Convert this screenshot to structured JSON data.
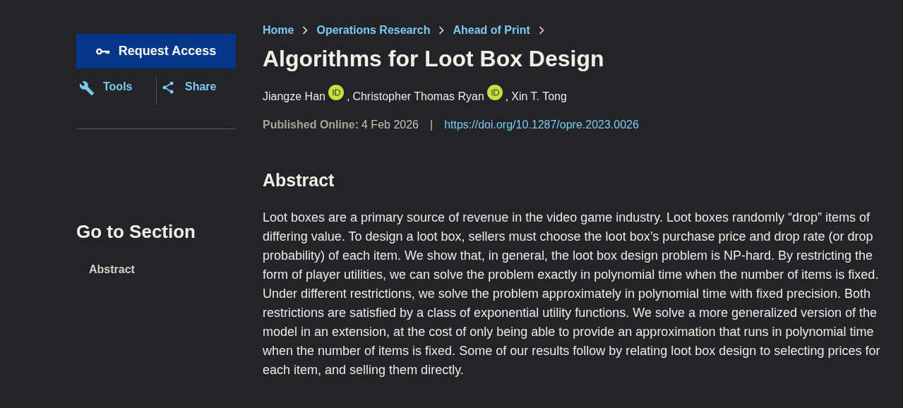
{
  "sidebar": {
    "request_access": "Request Access",
    "tools": "Tools",
    "share": "Share",
    "section_heading": "Go to Section",
    "sections": [
      {
        "label": "Abstract"
      }
    ]
  },
  "breadcrumbs": [
    "Home",
    "Operations Research",
    "Ahead of Print"
  ],
  "title": "Algorithms for Loot Box Design",
  "authors": [
    {
      "name": "Jiangze Han",
      "orcid": true,
      "separator": ","
    },
    {
      "name": "Christopher Thomas Ryan",
      "orcid": true,
      "separator": ","
    },
    {
      "name": "Xin T. Tong",
      "orcid": false
    }
  ],
  "published": {
    "label": "Published Online:",
    "date": "4 Feb 2026",
    "separator": "|",
    "doi": "https://doi.org/10.1287/opre.2023.0026"
  },
  "abstract": {
    "heading": "Abstract",
    "text": "Loot boxes are a primary source of revenue in the video game industry. Loot boxes randomly “drop” items of differing value. To design a loot box, sellers must choose the loot box’s purchase price and drop rate (or drop probability) of each item. We show that, in general, the loot box design problem is NP-hard. By restricting the form of player utilities, we can solve the problem exactly in polynomial time when the number of items is fixed. Under different restrictions, we solve the problem approximately in polynomial time with fixed precision. Both restrictions are satisfied by a class of exponential utility functions. We solve a more generalized version of the model in an extension, at the cost of only being able to provide an approximation that runs in polynomial time when the number of items is fixed. Some of our results follow by relating loot box design to selecting prices for each item, and selling them directly."
  }
}
